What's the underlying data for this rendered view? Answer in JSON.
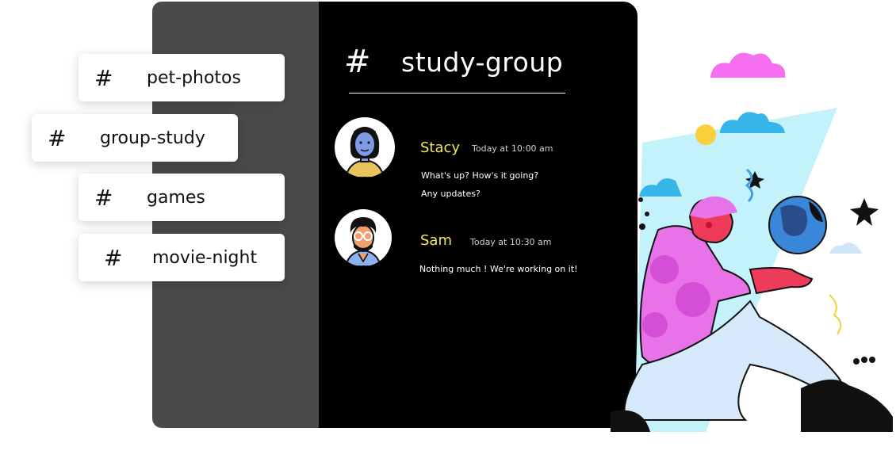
{
  "channels": [
    {
      "hash": "#",
      "label": "pet-photos"
    },
    {
      "hash": "#",
      "label": "group-study"
    },
    {
      "hash": "#",
      "label": "games"
    },
    {
      "hash": "#",
      "label": "movie-night"
    }
  ],
  "chat": {
    "hash": "#",
    "title": "study-group",
    "messages": [
      {
        "name": "Stacy",
        "time": "Today at 10:00 am",
        "lines": [
          "What's up? How's it going?",
          "Any updates?"
        ]
      },
      {
        "name": "Sam",
        "time": "Today at 10:30 am",
        "lines": [
          "Nothing much ! We're working on it!"
        ]
      }
    ]
  },
  "colors": {
    "name_accent": "#f2e85c",
    "chat_bg": "#000000",
    "sidebar_bg": "#4a4a4a"
  },
  "icons": {
    "avatar_stacy": "woman-avatar-icon",
    "avatar_sam": "man-avatar-icon"
  }
}
